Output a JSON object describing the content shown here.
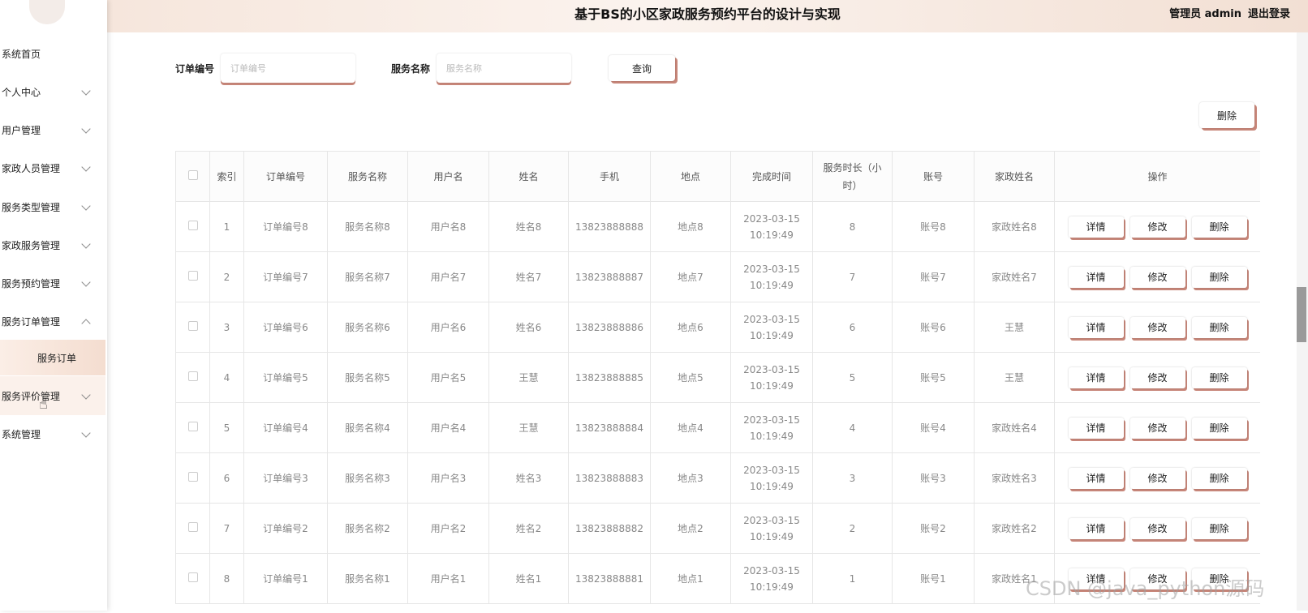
{
  "header": {
    "title": "基于BS的小区家政服务预约平台的设计与实现",
    "user_label": "管理员 admin",
    "logout": "退出登录"
  },
  "sidebar": {
    "items": [
      {
        "label": "系统首页"
      },
      {
        "label": "个人中心"
      },
      {
        "label": "用户管理"
      },
      {
        "label": "家政人员管理"
      },
      {
        "label": "服务类型管理"
      },
      {
        "label": "家政服务管理"
      },
      {
        "label": "服务预约管理"
      },
      {
        "label": "服务订单管理"
      },
      {
        "label": "服务订单"
      },
      {
        "label": "服务评价管理"
      },
      {
        "label": "系统管理"
      }
    ]
  },
  "search": {
    "order_label": "订单编号",
    "order_placeholder": "订单编号",
    "service_label": "服务名称",
    "service_placeholder": "服务名称",
    "query_button": "查询"
  },
  "toolbar": {
    "delete_button": "删除"
  },
  "table": {
    "headers": [
      "索引",
      "订单编号",
      "服务名称",
      "用户名",
      "姓名",
      "手机",
      "地点",
      "完成时间",
      "服务时长（小时）",
      "账号",
      "家政姓名",
      "操作"
    ],
    "actions": {
      "detail": "详情",
      "edit": "修改",
      "delete": "删除"
    },
    "rows": [
      {
        "index": "1",
        "order": "订单编号8",
        "service": "服务名称8",
        "username": "用户名8",
        "name": "姓名8",
        "phone": "13823888888",
        "place": "地点8",
        "time": "2023-03-15 10:19:49",
        "hours": "8",
        "account": "账号8",
        "staff": "家政姓名8"
      },
      {
        "index": "2",
        "order": "订单编号7",
        "service": "服务名称7",
        "username": "用户名7",
        "name": "姓名7",
        "phone": "13823888887",
        "place": "地点7",
        "time": "2023-03-15 10:19:49",
        "hours": "7",
        "account": "账号7",
        "staff": "家政姓名7"
      },
      {
        "index": "3",
        "order": "订单编号6",
        "service": "服务名称6",
        "username": "用户名6",
        "name": "姓名6",
        "phone": "13823888886",
        "place": "地点6",
        "time": "2023-03-15 10:19:49",
        "hours": "6",
        "account": "账号6",
        "staff": "王慧"
      },
      {
        "index": "4",
        "order": "订单编号5",
        "service": "服务名称5",
        "username": "用户名5",
        "name": "王慧",
        "phone": "13823888885",
        "place": "地点5",
        "time": "2023-03-15 10:19:49",
        "hours": "5",
        "account": "账号5",
        "staff": "王慧"
      },
      {
        "index": "5",
        "order": "订单编号4",
        "service": "服务名称4",
        "username": "用户名4",
        "name": "王慧",
        "phone": "13823888884",
        "place": "地点4",
        "time": "2023-03-15 10:19:49",
        "hours": "4",
        "account": "账号4",
        "staff": "家政姓名4"
      },
      {
        "index": "6",
        "order": "订单编号3",
        "service": "服务名称3",
        "username": "用户名3",
        "name": "姓名3",
        "phone": "13823888883",
        "place": "地点3",
        "time": "2023-03-15 10:19:49",
        "hours": "3",
        "account": "账号3",
        "staff": "家政姓名3"
      },
      {
        "index": "7",
        "order": "订单编号2",
        "service": "服务名称2",
        "username": "用户名2",
        "name": "姓名2",
        "phone": "13823888882",
        "place": "地点2",
        "time": "2023-03-15 10:19:49",
        "hours": "2",
        "account": "账号2",
        "staff": "家政姓名2"
      },
      {
        "index": "8",
        "order": "订单编号1",
        "service": "服务名称1",
        "username": "用户名1",
        "name": "姓名1",
        "phone": "13823888881",
        "place": "地点1",
        "time": "2023-03-15 10:19:49",
        "hours": "1",
        "account": "账号1",
        "staff": "家政姓名1"
      }
    ]
  },
  "watermark": "CSDN @java_python源码",
  "colors": {
    "accent": "#c8877a",
    "header_bg": "#f6e6dc",
    "active_item_bg": "#f4ddd0"
  }
}
